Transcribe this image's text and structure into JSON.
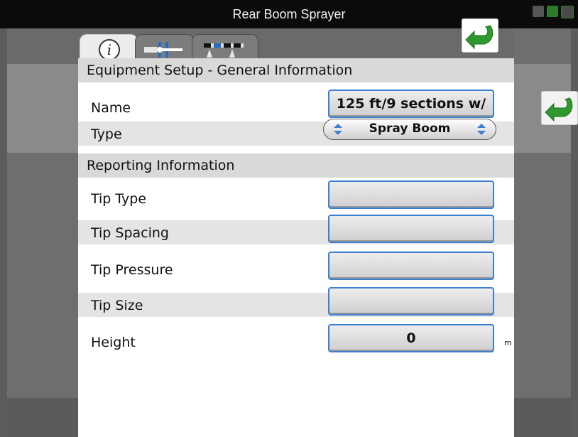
{
  "window": {
    "title": "Rear Boom Sprayer"
  },
  "tabs": [
    {
      "name": "info",
      "icon": "info-icon",
      "active": true
    },
    {
      "name": "tools",
      "icon": "hitch-tools-icon",
      "active": false
    },
    {
      "name": "boom-sections",
      "icon": "boom-sections-icon",
      "active": false
    }
  ],
  "header": {
    "general": "Equipment Setup - General Information",
    "reporting": "Reporting Information"
  },
  "fields": {
    "name": {
      "label": "Name",
      "value": "125 ft/9 sections w/"
    },
    "type": {
      "label": "Type",
      "value": "Spray Boom"
    },
    "tip_type": {
      "label": "Tip Type",
      "value": ""
    },
    "tip_spacing": {
      "label": "Tip Spacing",
      "value": ""
    },
    "tip_pressure": {
      "label": "Tip Pressure",
      "value": ""
    },
    "tip_size": {
      "label": "Tip Size",
      "value": ""
    },
    "height": {
      "label": "Height",
      "value": "0",
      "unit": "m"
    }
  },
  "colors": {
    "accent_blue": "#3a7fd0",
    "back_green": "#2e9a2e",
    "titlebar": "#0b0b0b"
  }
}
